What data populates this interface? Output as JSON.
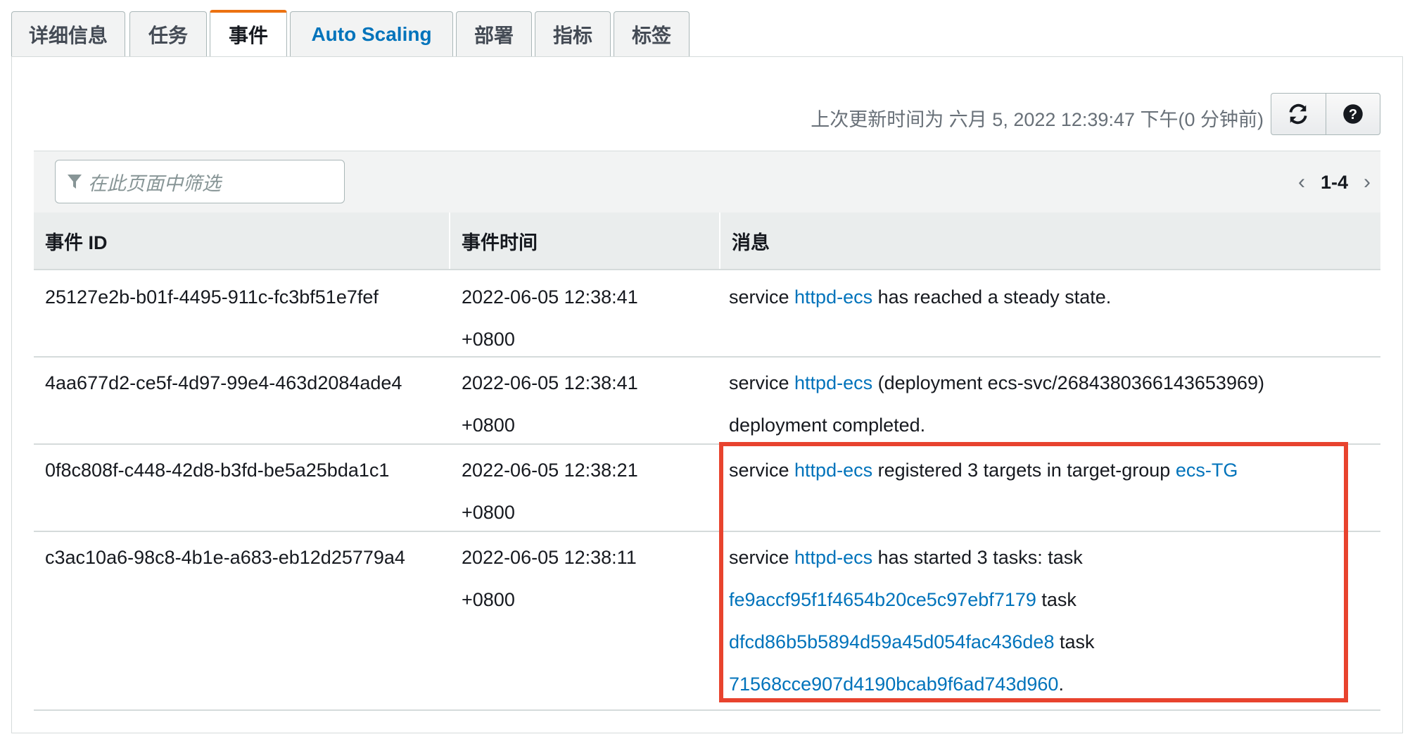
{
  "tabs": [
    {
      "label": "详细信息"
    },
    {
      "label": "任务"
    },
    {
      "label": "事件"
    },
    {
      "label": "Auto Scaling"
    },
    {
      "label": "部署"
    },
    {
      "label": "指标"
    },
    {
      "label": "标签"
    }
  ],
  "toolbar": {
    "last_updated": "上次更新时间为 六月 5, 2022 12:39:47 下午(0 分钟前)",
    "refresh_icon": "refresh-icon",
    "help_icon": "help-icon"
  },
  "filter": {
    "placeholder": "在此页面中筛选",
    "icon": "filter-icon"
  },
  "pagination": {
    "range": "1-4"
  },
  "table": {
    "headers": {
      "id": "事件 ID",
      "time": "事件时间",
      "message": "消息"
    },
    "rows": [
      {
        "id": "25127e2b-b01f-4495-911c-fc3bf51e7fef",
        "date": "2022-06-05 12:38:41",
        "tz": "+0800",
        "msg_a": "service ",
        "msg_link1": "httpd-ecs",
        "msg_b": " has reached a steady state."
      },
      {
        "id": "4aa677d2-ce5f-4d97-99e4-463d2084ade4",
        "date": "2022-06-05 12:38:41",
        "tz": "+0800",
        "msg_a": "service ",
        "msg_link1": "httpd-ecs",
        "msg_b": " (deployment ecs-svc/2684380366143653969)",
        "msg_c": "deployment completed."
      },
      {
        "id": "0f8c808f-c448-42d8-b3fd-be5a25bda1c1",
        "date": "2022-06-05 12:38:21",
        "tz": "+0800",
        "msg_a": "service ",
        "msg_link1": "httpd-ecs",
        "msg_b": " registered 3 targets in target-group ",
        "msg_link2": "ecs-TG"
      },
      {
        "id": "c3ac10a6-98c8-4b1e-a683-eb12d25779a4",
        "date": "2022-06-05 12:38:11",
        "tz": "+0800",
        "msg_a": "service ",
        "msg_link1": "httpd-ecs",
        "msg_b": " has started 3 tasks: task",
        "task1": "fe9accf95f1f4654b20ce5c97ebf7179",
        "task1_suffix": " task",
        "task2": "dfcd86b5b5894d59a45d054fac436de8",
        "task2_suffix": " task",
        "task3": "71568cce907d4190bcab9f6ad743d960",
        "task3_suffix": "."
      }
    ]
  },
  "colors": {
    "accent_tab": "#ec7211",
    "link": "#0073bb",
    "highlight": "#e8432e"
  }
}
